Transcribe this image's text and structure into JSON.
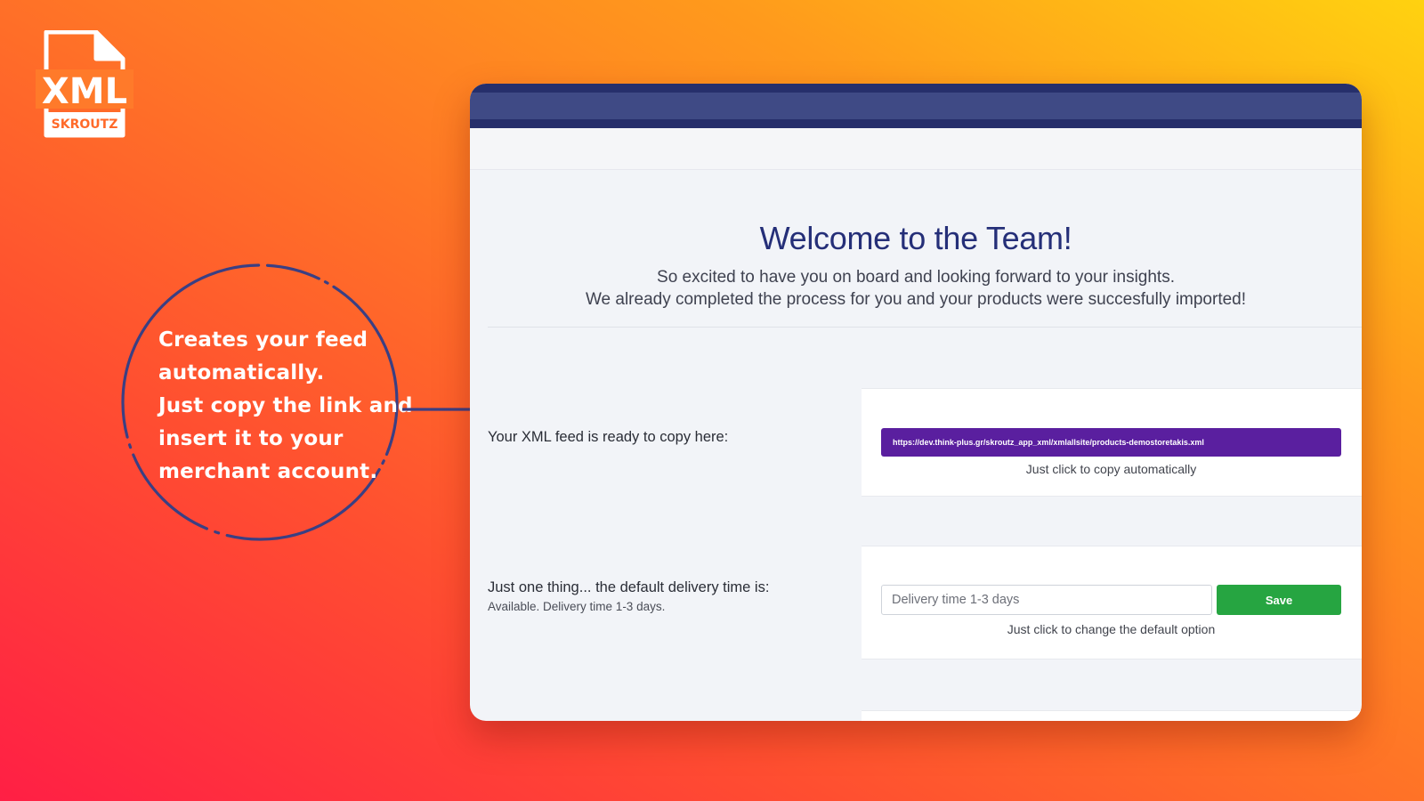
{
  "logo": {
    "icon": "xml-file-icon",
    "text": "XML",
    "brand": "SKROUTZ"
  },
  "callout": {
    "lines": [
      "Creates your feed",
      "automatically.",
      "Just copy the link and",
      "insert it to your",
      "merchant account."
    ]
  },
  "app": {
    "welcome_title": "Welcome to the Team!",
    "welcome_line1": "So excited to have you on board and looking forward to your insights.",
    "welcome_line2": "We already completed the process for you and your products were succesfully imported!",
    "feed": {
      "label": "Your XML feed is ready to copy here:",
      "url": "https://dev.think-plus.gr/skroutz_app_xml/xmlallsite/products-demostoretakis.xml",
      "hint": "Just click to copy automatically"
    },
    "delivery": {
      "label": "Just one thing... the default delivery time is:",
      "sub": "Available. Delivery time 1-3 days.",
      "input_placeholder": "Delivery time 1-3 days",
      "save_label": "Save",
      "hint": "Just click to change the default option"
    }
  },
  "colors": {
    "brand_navy": "#252f78",
    "feed_purple": "#5a1f9f",
    "save_green": "#26a541"
  }
}
